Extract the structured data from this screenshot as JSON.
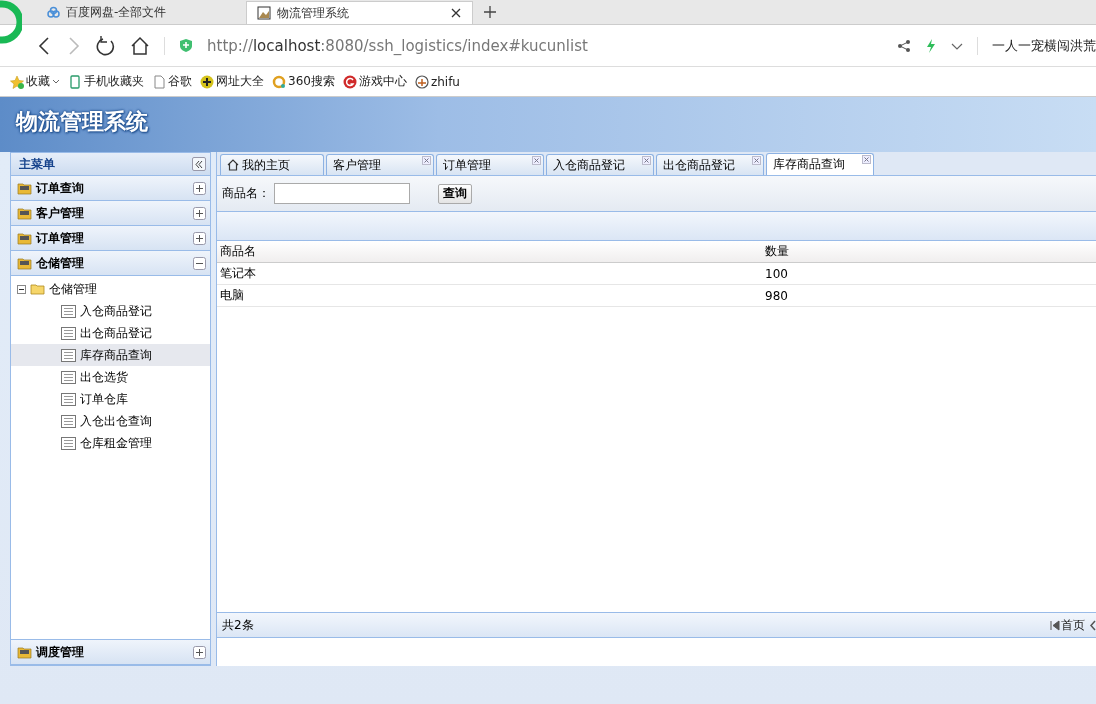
{
  "browser": {
    "tabs": [
      {
        "title": "百度网盘-全部文件",
        "selected": false
      },
      {
        "title": "物流管理系统",
        "selected": true
      }
    ],
    "address": "http://**localhost**:8080/ssh_logistics/index#kucunlist",
    "account": "一人一宠横闯洪荒",
    "bookmarks": [
      {
        "label": "收藏",
        "kind": "star",
        "dropdown": true
      },
      {
        "label": "手机收藏夹",
        "kind": "phone",
        "dropdown": false
      },
      {
        "label": "谷歌",
        "kind": "page",
        "dropdown": false
      },
      {
        "label": "网址大全",
        "kind": "plus",
        "dropdown": false
      },
      {
        "label": "360搜索",
        "kind": "ring",
        "dropdown": false
      },
      {
        "label": "游戏中心",
        "kind": "game",
        "dropdown": false
      },
      {
        "label": "zhifu",
        "kind": "coin",
        "dropdown": false
      }
    ]
  },
  "app": {
    "title": "物流管理系统"
  },
  "sidebar": {
    "title": "主菜单",
    "sections": [
      {
        "label": "订单查询",
        "expanded": false
      },
      {
        "label": "客户管理",
        "expanded": false
      },
      {
        "label": "订单管理",
        "expanded": false
      },
      {
        "label": "仓储管理",
        "expanded": true,
        "tree": {
          "label": "仓储管理",
          "expanded": true,
          "children": [
            {
              "label": "入仓商品登记",
              "selected": false
            },
            {
              "label": "出仓商品登记",
              "selected": false
            },
            {
              "label": "库存商品查询",
              "selected": true
            },
            {
              "label": "出仓选货",
              "selected": false
            },
            {
              "label": "订单仓库",
              "selected": false
            },
            {
              "label": "入仓出仓查询",
              "selected": false
            },
            {
              "label": "仓库租金管理",
              "selected": false
            }
          ]
        }
      },
      {
        "label": "调度管理",
        "expanded": false
      }
    ]
  },
  "tabs": [
    {
      "label": "我的主页",
      "selected": false,
      "kind": "home"
    },
    {
      "label": "客户管理",
      "selected": false,
      "kind": "closable"
    },
    {
      "label": "订单管理",
      "selected": false,
      "kind": "closable"
    },
    {
      "label": "入仓商品登记",
      "selected": false,
      "kind": "closable"
    },
    {
      "label": "出仓商品登记",
      "selected": false,
      "kind": "closable"
    },
    {
      "label": "库存商品查询",
      "selected": true,
      "kind": "closable"
    }
  ],
  "search": {
    "label": "商品名：",
    "button": "查询"
  },
  "table": {
    "columns": [
      "商品名",
      "数量"
    ],
    "rows": [
      [
        "笔记本",
        "100"
      ],
      [
        "电脑",
        "980"
      ]
    ]
  },
  "pager": {
    "total": "共2条",
    "first": "首页"
  }
}
